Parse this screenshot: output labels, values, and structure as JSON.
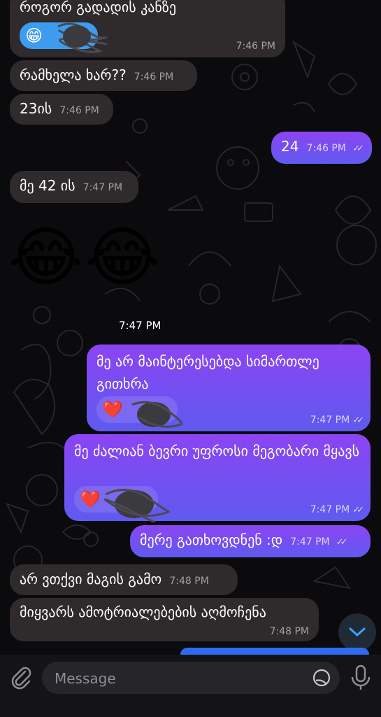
{
  "messages": [
    {
      "id": "m1",
      "dir": "in",
      "text": "როგორ გადადის კანზე",
      "time": "7:46 PM",
      "reaction": "😁"
    },
    {
      "id": "m2",
      "dir": "in",
      "text": "რამხელა ხარ??",
      "time": "7:46 PM"
    },
    {
      "id": "m3",
      "dir": "in",
      "text": "23ის",
      "time": "7:46 PM"
    },
    {
      "id": "m4",
      "dir": "out",
      "text": "24",
      "time": "7:46 PM"
    },
    {
      "id": "m5",
      "dir": "in",
      "text": "მე 42 ის",
      "time": "7:47 PM"
    },
    {
      "id": "m6",
      "dir": "in",
      "emoji": "😂😂",
      "time": "7:47 PM"
    },
    {
      "id": "m7",
      "dir": "out",
      "text": "მე არ მაინტერესებდა სიმართლე გითხრა",
      "time": "7:47 PM",
      "reaction": "❤️"
    },
    {
      "id": "m8",
      "dir": "out",
      "text": "მე ძალიან ბევრი უფროსი მეგობარი მყავს",
      "time": "7:47 PM",
      "reaction": "❤️"
    },
    {
      "id": "m9",
      "dir": "out",
      "text": "მერე გათხოვდნენ :დ",
      "time": "7:47 PM"
    },
    {
      "id": "m10",
      "dir": "in",
      "text": "არ ვთქვი მაგის გამო",
      "time": "7:48 PM"
    },
    {
      "id": "m11",
      "dir": "in",
      "text": "მიყვარს ამოტრიალებების აღმოჩენა",
      "time": "7:48 PM"
    }
  ],
  "composer": {
    "placeholder": "Message"
  },
  "icons": {
    "attach": "paperclip-icon",
    "sticker": "sticker-icon",
    "mic": "microphone-icon",
    "scroll": "chevron-down-icon",
    "read": "double-check-icon"
  },
  "colors": {
    "incoming_bubble": "#2f2a2c",
    "outgoing_top": "#8c44f2",
    "outgoing_bottom": "#5f5af0",
    "background": "#0b0a0c"
  }
}
